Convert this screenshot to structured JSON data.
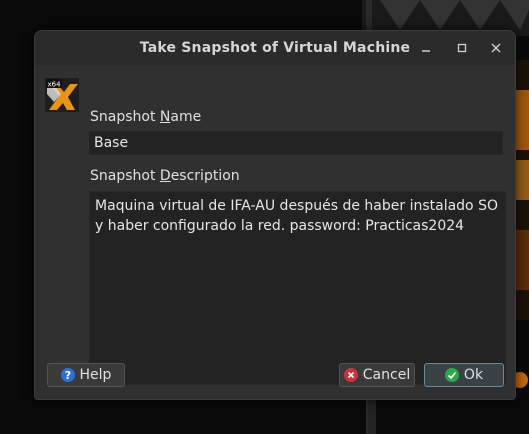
{
  "window": {
    "title": "Take Snapshot of Virtual Machine"
  },
  "vm_icon": {
    "badge_text": "x64",
    "icon": "os-logo-icon"
  },
  "snapshot_name": {
    "label_before": "Snapshot ",
    "label_mnemonic": "N",
    "label_after": "ame",
    "value": "Base"
  },
  "snapshot_description": {
    "label_before": "Snapshot ",
    "label_mnemonic": "D",
    "label_after": "escription",
    "value": "Maquina virtual de IFA-AU después de haber instalado SO y haber configurado la red. password: Practicas2024"
  },
  "buttons": {
    "help": "Help",
    "cancel": "Cancel",
    "ok": "Ok"
  },
  "colors": {
    "help_icon": "#2f6fd0",
    "cancel_icon": "#d0303a",
    "ok_icon": "#2ea84a",
    "accent_orange": "#e8921a"
  }
}
